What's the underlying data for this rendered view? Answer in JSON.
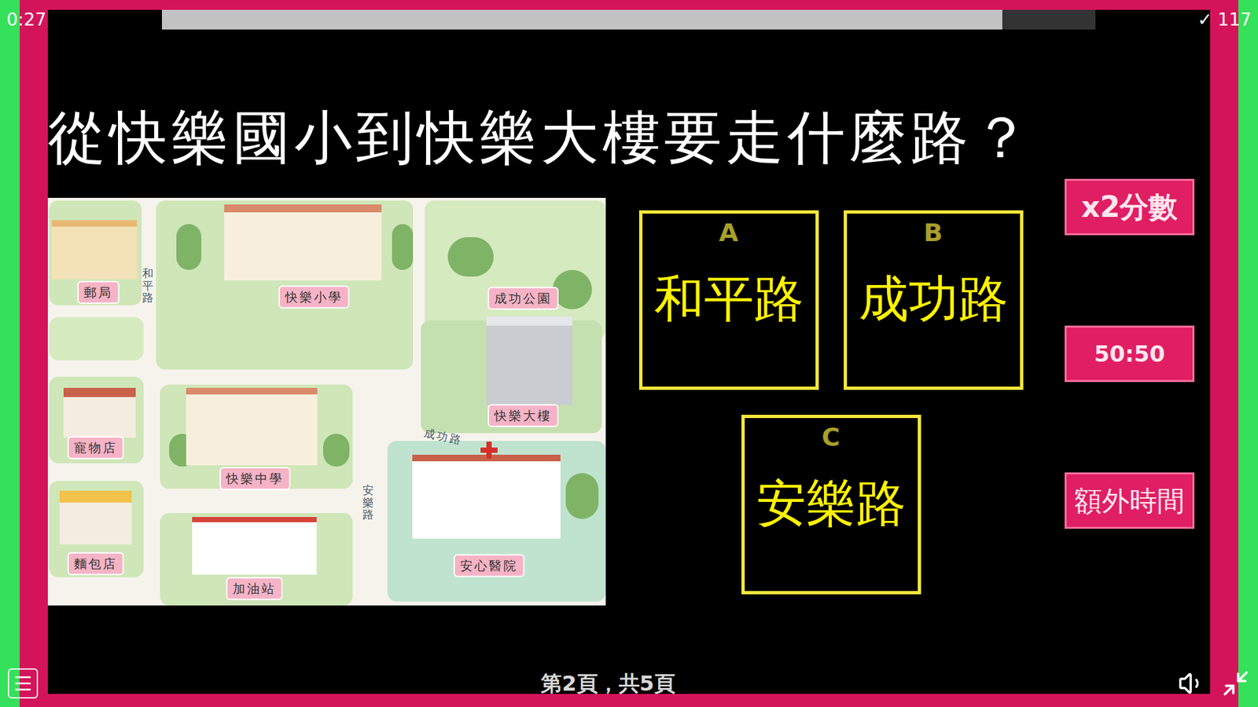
{
  "timer": "0:27",
  "progress": {
    "level": 0.9
  },
  "score": {
    "icon": "✓",
    "value": "117"
  },
  "question": "從快樂國小到快樂大樓要走什麼路？",
  "map": {
    "labels": [
      {
        "text": "郵局",
        "kind": "place"
      },
      {
        "text": "和平路",
        "kind": "road-vertical"
      },
      {
        "text": "快樂小學",
        "kind": "place"
      },
      {
        "text": "成功公園",
        "kind": "place"
      },
      {
        "text": "快樂大樓",
        "kind": "place"
      },
      {
        "text": "成功路",
        "kind": "road"
      },
      {
        "text": "寵物店",
        "kind": "place"
      },
      {
        "text": "快樂中學",
        "kind": "place"
      },
      {
        "text": "安樂路",
        "kind": "road-vertical"
      },
      {
        "text": "麵包店",
        "kind": "place"
      },
      {
        "text": "加油站",
        "kind": "place"
      },
      {
        "text": "安心醫院",
        "kind": "place"
      }
    ]
  },
  "answers": [
    {
      "letter": "A",
      "text": "和平路"
    },
    {
      "letter": "B",
      "text": "成功路"
    },
    {
      "letter": "C",
      "text": "安樂路"
    }
  ],
  "powerups": [
    {
      "label": "x2分數"
    },
    {
      "label": "50:50"
    },
    {
      "label": "額外時間"
    }
  ],
  "footer": {
    "page": "第2頁，共5頁"
  }
}
